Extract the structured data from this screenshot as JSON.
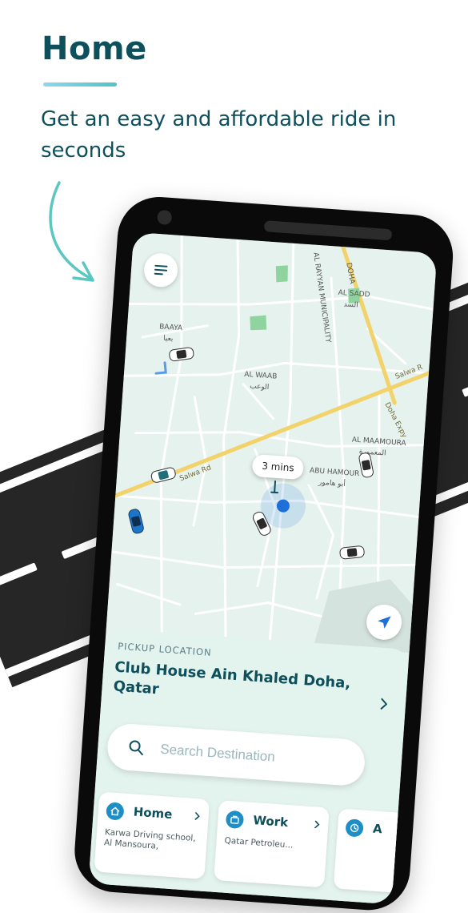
{
  "header": {
    "title": "Home",
    "subtitle": "Get an easy and affordable ride in seconds"
  },
  "map": {
    "labels": {
      "al_sadd": "AL SADD",
      "al_sadd_ar": "السد",
      "baaya": "BAAYA",
      "baaya_ar": "بعيا",
      "al_waab": "AL WAAB",
      "al_waab_ar": "الوعب",
      "al_maamoura": "AL MAAMOURA",
      "al_maamoura_ar": "المعمورة",
      "abu_hamour": "ABU HAMOUR",
      "abu_hamour_ar": "أبو هامور",
      "al_rayyan_municipality": "AL RAYYAN MUNICIPALITY",
      "doha": "DOHA",
      "salwa_rd": "Salwa Rd",
      "salwa_rd_2": "Salwa R",
      "doha_expy": "Doha Expy"
    },
    "eta_bubble": "3 mins"
  },
  "icons": {
    "menu": "hamburger-menu-icon",
    "locate": "navigation-arrow-icon",
    "search": "magnifier-icon",
    "chevron": "chevron-right-icon",
    "home": "house-icon",
    "work": "briefcase-icon",
    "recent": "clock-icon"
  },
  "pickup": {
    "label": "PICKUP LOCATION",
    "address": "Club House Ain Khaled Doha, Qatar"
  },
  "search": {
    "placeholder": "Search Destination"
  },
  "favorites": [
    {
      "title": "Home",
      "subtitle": "Karwa Driving school, Al Mansoura,"
    },
    {
      "title": "Work",
      "subtitle": "Qatar Petroleu..."
    },
    {
      "title": "A"
    }
  ],
  "colors": {
    "heading": "#0e4f5c",
    "accent_teal": "#4fc3c8",
    "map_background": "#e6f2ee",
    "main_road": "#f2d36b",
    "user_dot": "#1e6fd9",
    "icon_blue": "#1e8ec7"
  }
}
